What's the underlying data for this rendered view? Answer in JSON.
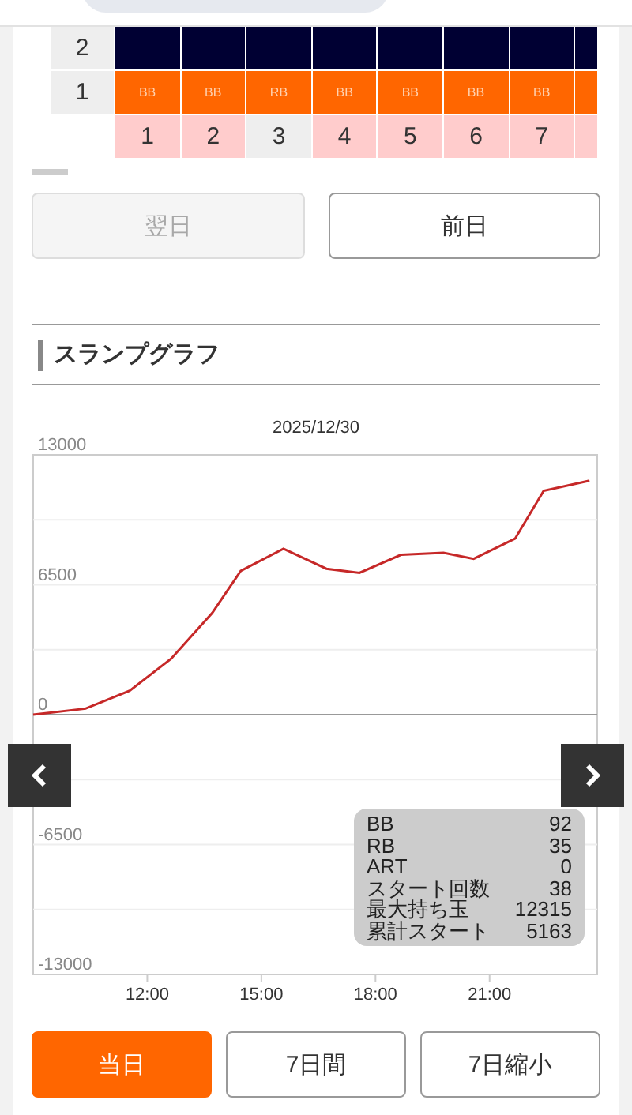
{
  "bonus_table": {
    "row_labels": [
      "2",
      "1"
    ],
    "columns": [
      {
        "bonus": "BB",
        "number": "1",
        "color": "#ffcccc"
      },
      {
        "bonus": "BB",
        "number": "2",
        "color": "#ffcccc"
      },
      {
        "bonus": "RB",
        "number": "3",
        "color": "#eeeeee"
      },
      {
        "bonus": "BB",
        "number": "4",
        "color": "#ffcccc"
      },
      {
        "bonus": "BB",
        "number": "5",
        "color": "#ffcccc"
      },
      {
        "bonus": "BB",
        "number": "6",
        "color": "#ffcccc"
      },
      {
        "bonus": "BB",
        "number": "7",
        "color": "#ffcccc"
      }
    ]
  },
  "day_nav": [
    {
      "label": "翌日",
      "disabled": true
    },
    {
      "label": "前日",
      "disabled": false
    }
  ],
  "section": {
    "title": "スランプグラフ"
  },
  "slump_chart": {
    "chart_data": {
      "type": "line",
      "title": "2025/12/30",
      "x": [
        9.0,
        10.375,
        11.54,
        12.625,
        13.71,
        14.46,
        15.58,
        16.71,
        17.58,
        18.67,
        19.79,
        20.58,
        21.67,
        22.42,
        23.625
      ],
      "series": [
        {
          "color": "#c62828",
          "values": [
            0,
            300,
            1200,
            2800,
            5100,
            7200,
            8300,
            7300,
            7100,
            8000,
            8100,
            7800,
            8800,
            11200,
            11700
          ]
        }
      ],
      "xlim": [
        9,
        23.83
      ],
      "ylim": [
        -13000,
        13000
      ],
      "xticks": [
        {
          "value": 12,
          "label": "12:00"
        },
        {
          "value": 15,
          "label": "15:00"
        },
        {
          "value": 18,
          "label": "18:00"
        },
        {
          "value": 21,
          "label": "21:00"
        }
      ],
      "yticks": [
        {
          "value": 13000,
          "label": "13000"
        },
        {
          "value": 6500,
          "label": "6500"
        },
        {
          "value": 0,
          "label": "0"
        },
        {
          "value": -6500,
          "label": "-6500"
        },
        {
          "value": -13000,
          "label": "-13000"
        }
      ]
    },
    "stats": [
      {
        "label": "BB",
        "value": "92"
      },
      {
        "label": "RB",
        "value": "35"
      },
      {
        "label": "ART",
        "value": "0"
      },
      {
        "label": "スタート回数",
        "value": "38"
      },
      {
        "label": "最大持ち玉",
        "value": "12315"
      },
      {
        "label": "累計スタート",
        "value": "5163"
      }
    ]
  },
  "range_tabs": [
    {
      "label": "当日",
      "selected": true
    },
    {
      "label": "7日間",
      "selected": false
    },
    {
      "label": "7日縮小",
      "selected": false
    }
  ]
}
